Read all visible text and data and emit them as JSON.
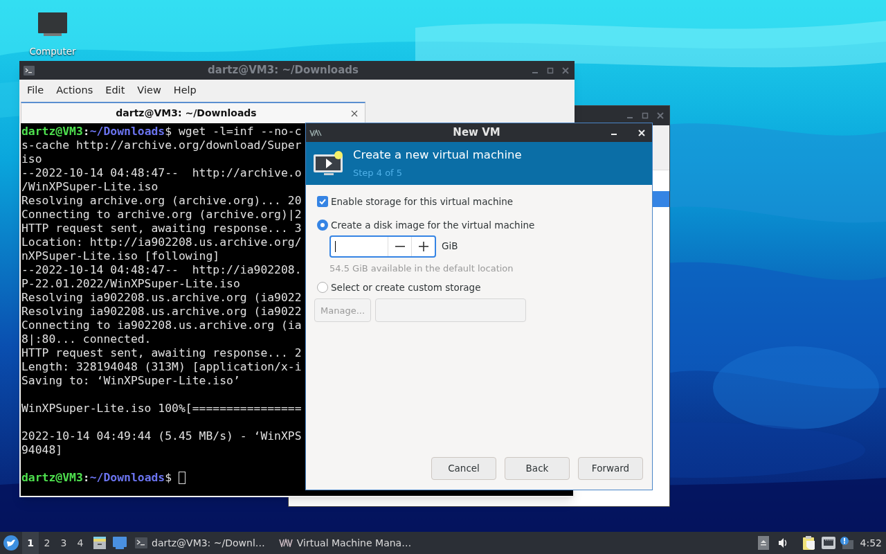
{
  "desktop": {
    "icons": [
      {
        "label": "Computer"
      }
    ]
  },
  "terminal_window": {
    "title": "dartz@VM3: ~/Downloads",
    "menu": [
      "File",
      "Actions",
      "Edit",
      "View",
      "Help"
    ],
    "tabs": [
      {
        "label": "dartz@VM3: ~/Downloads",
        "selected": true
      }
    ],
    "lines": [
      {
        "kind": "prompt",
        "user": "dartz@VM3",
        "separator": ":",
        "path": "~/Downloads",
        "command": "$ wget -l=inf --no-c",
        "cursor": false
      },
      {
        "kind": "text",
        "text": "s-cache http://archive.org/download/Super"
      },
      {
        "kind": "text",
        "text": "iso"
      },
      {
        "kind": "text",
        "text": "--2022-10-14 04:48:47--  http://archive.o"
      },
      {
        "kind": "text",
        "text": "/WinXPSuper-Lite.iso"
      },
      {
        "kind": "text",
        "text": "Resolving archive.org (archive.org)... 20"
      },
      {
        "kind": "text",
        "text": "Connecting to archive.org (archive.org)|2"
      },
      {
        "kind": "text",
        "text": "HTTP request sent, awaiting response... 3"
      },
      {
        "kind": "text",
        "text": "Location: http://ia902208.us.archive.org/"
      },
      {
        "kind": "text",
        "text": "nXPSuper-Lite.iso [following]"
      },
      {
        "kind": "text",
        "text": "--2022-10-14 04:48:47--  http://ia902208."
      },
      {
        "kind": "text",
        "text": "P-22.01.2022/WinXPSuper-Lite.iso"
      },
      {
        "kind": "text",
        "text": "Resolving ia902208.us.archive.org (ia9022"
      },
      {
        "kind": "text",
        "text": "Resolving ia902208.us.archive.org (ia9022"
      },
      {
        "kind": "text",
        "text": "Connecting to ia902208.us.archive.org (ia"
      },
      {
        "kind": "text",
        "text": "8|:80... connected."
      },
      {
        "kind": "text",
        "text": "HTTP request sent, awaiting response... 2"
      },
      {
        "kind": "text",
        "text": "Length: 328194048 (313M) [application/x-i"
      },
      {
        "kind": "text",
        "text": "Saving to: ‘WinXPSuper-Lite.iso’"
      },
      {
        "kind": "blank"
      },
      {
        "kind": "text",
        "text": "WinXPSuper-Lite.iso 100%[================"
      },
      {
        "kind": "blank"
      },
      {
        "kind": "text",
        "text": "2022-10-14 04:49:44 (5.45 MB/s) - ‘WinXPS"
      },
      {
        "kind": "text",
        "text": "94048]"
      },
      {
        "kind": "blank"
      },
      {
        "kind": "prompt",
        "user": "dartz@VM3",
        "separator": ":",
        "path": "~/Downloads",
        "command": "$ ",
        "cursor": true
      }
    ]
  },
  "dialog": {
    "title": "New VM",
    "heading": "Create a new virtual machine",
    "step": "Step 4 of 5",
    "enable_storage": {
      "label": "Enable storage for this virtual machine",
      "checked": true
    },
    "storage_options": [
      {
        "label": "Create a disk image for the virtual machine",
        "selected": true
      },
      {
        "label": "Select or create custom storage",
        "selected": false
      }
    ],
    "disk_size": {
      "unit": "GiB",
      "hint": "54.5 GiB available in the default location"
    },
    "manage_button": {
      "label": "Manage...",
      "disabled": true
    },
    "buttons": [
      "Cancel",
      "Back",
      "Forward"
    ]
  },
  "taskbar": {
    "workspaces": [
      {
        "label": "1",
        "selected": true
      },
      {
        "label": "2",
        "selected": false
      },
      {
        "label": "3",
        "selected": false
      },
      {
        "label": "4",
        "selected": false
      }
    ],
    "tasks": [
      {
        "kind": "terminal",
        "label": "dartz@VM3: ~/Downl…"
      },
      {
        "kind": "vm",
        "label": "Virtual Machine Mana…"
      }
    ],
    "clock": "4:52"
  }
}
